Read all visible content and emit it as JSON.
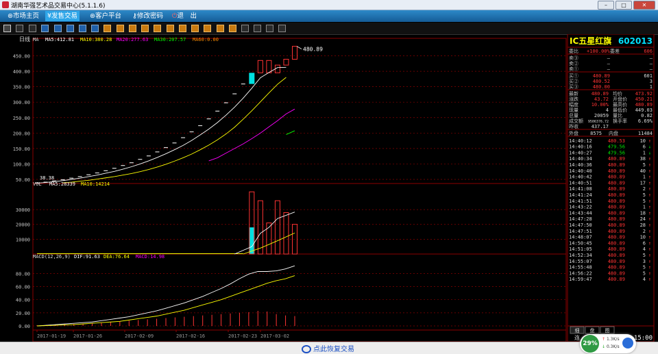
{
  "window": {
    "title": "湖南华强艺术品交易中心(5.1.1.6)"
  },
  "menu": [
    {
      "label": "市场主页",
      "icon": "globe-icon"
    },
    {
      "label": "发售交易",
      "icon": "money-icon",
      "active": true
    },
    {
      "label": "客户平台",
      "icon": "globe-icon"
    },
    {
      "label": "修改密码",
      "icon": "key-icon"
    },
    {
      "label": "退　出",
      "icon": "exit-icon"
    }
  ],
  "status": {
    "resume": "点此恢复交易"
  },
  "netwidget": {
    "percent": "29%",
    "up": "1.3K/s",
    "down": "0.3K/s"
  },
  "chart_data": [
    {
      "type": "candlestick",
      "title": "日线",
      "indicators_label": "MA",
      "ma_labels": [
        {
          "text": "MA5:412.81",
          "color": "#ffffff"
        },
        {
          "text": "MA10:380.28",
          "color": "#ffff00"
        },
        {
          "text": "MA20:277.63",
          "color": "#ff00ff"
        },
        {
          "text": "MA30:207.57",
          "color": "#00ff00"
        },
        {
          "text": "MA60:0.00",
          "color": "#ff8c00"
        }
      ],
      "yticks": [
        "450.00",
        "400.00",
        "350.00",
        "300.00",
        "250.00",
        "200.00",
        "150.00",
        "100.00",
        "50.00"
      ],
      "ylim": [
        50,
        480
      ],
      "xticks": [
        "2017-01-19",
        "2017-01-26",
        "2017-02-09",
        "2017-02-16",
        "2017-02-23",
        "2017-03-02"
      ],
      "high_label": "480.89",
      "low_label": "38.38",
      "close": [
        38.38,
        41,
        45,
        49,
        54,
        59,
        65,
        71,
        78,
        86,
        95,
        104,
        115,
        126,
        139,
        153,
        168,
        185,
        204,
        224,
        246,
        271,
        298,
        327,
        359,
        395,
        435,
        395,
        420,
        439,
        480.89
      ],
      "ma5": [
        38,
        40,
        43,
        46,
        50,
        54,
        59,
        64,
        70,
        76,
        83,
        91,
        100,
        110,
        121,
        133,
        146,
        160,
        176,
        194,
        213,
        234,
        258,
        284,
        313,
        345,
        379,
        396,
        412,
        412.81
      ],
      "ma10": [
        39,
        41,
        44,
        47,
        51,
        55,
        59,
        64,
        69,
        75,
        82,
        90,
        99,
        109,
        120,
        132,
        146,
        161,
        178,
        197,
        219,
        245,
        272,
        301,
        330,
        358,
        380.28
      ],
      "ma20": [
        110,
        120,
        135,
        150,
        165,
        182,
        200,
        220,
        240,
        262,
        277.63
      ],
      "ma30": [
        195,
        207.57
      ]
    },
    {
      "type": "bar",
      "title": "VOL",
      "ma_labels": [
        {
          "text": "MA5:28339",
          "color": "#ffffff"
        },
        {
          "text": "MA10:14214",
          "color": "#ffff00"
        }
      ],
      "yticks": [
        "30000",
        "20000",
        "10000"
      ],
      "ylim": [
        0,
        43000
      ],
      "values": [
        18000,
        42000,
        36000,
        21000,
        36000,
        28000,
        20059
      ]
    },
    {
      "type": "line",
      "title": "MACD(12,26,9)",
      "ma_labels": [
        {
          "text": "DIF:91.63",
          "color": "#ffffff"
        },
        {
          "text": "DEA:76.64",
          "color": "#ffff00"
        },
        {
          "text": "MACD:14.98",
          "color": "#ff00ff"
        }
      ],
      "yticks": [
        "80.00",
        "60.00",
        "40.00",
        "20.00",
        "0.00"
      ],
      "ylim": [
        0,
        95
      ],
      "dif": [
        0,
        1,
        2,
        3,
        4,
        5,
        6,
        8,
        10,
        12,
        14,
        17,
        20,
        23,
        27,
        31,
        35,
        40,
        45,
        51,
        57,
        64,
        72,
        79,
        83,
        83,
        84,
        87,
        91.63
      ],
      "dea": [
        0,
        0.5,
        1,
        1.5,
        2,
        3,
        4,
        5,
        6,
        7,
        9,
        11,
        13,
        15,
        18,
        21,
        24,
        28,
        32,
        36,
        40,
        45,
        50,
        55,
        60,
        65,
        69,
        72,
        76.64
      ],
      "hist": [
        1,
        1.5,
        2,
        2.5,
        3,
        3.5,
        4,
        5,
        6,
        7,
        8,
        9,
        10,
        11,
        12,
        13,
        14,
        15,
        16,
        17,
        18,
        19,
        20,
        21,
        23,
        22,
        18,
        16,
        14.98
      ]
    }
  ],
  "quote": {
    "name": "IC五星红旗",
    "code": "602013",
    "weibi": {
      "label": "委比",
      "value": "+100.00%",
      "diff_label": "委差",
      "diff": "606"
    },
    "sells": [
      {
        "label": "卖③",
        "price": "—",
        "vol": "—"
      },
      {
        "label": "卖②",
        "price": "—",
        "vol": "—"
      },
      {
        "label": "卖①",
        "price": "—",
        "vol": "—"
      }
    ],
    "buys": [
      {
        "label": "买①",
        "price": "480.89",
        "vol": "601"
      },
      {
        "label": "买②",
        "price": "480.52",
        "vol": "3"
      },
      {
        "label": "买③",
        "price": "480.00",
        "vol": "1"
      }
    ],
    "stats": [
      {
        "l1": "最新",
        "v1": "480.89",
        "l2": "均价",
        "v2": "473.92"
      },
      {
        "l1": "涨跌",
        "v1": "43.72",
        "l2": "开盘价",
        "v2": "450.21"
      },
      {
        "l1": "幅度",
        "v1": "10.00%",
        "l2": "最高价",
        "v2": "480.89"
      },
      {
        "l1": "现量",
        "v1": "4",
        "l2": "最低价",
        "v2": "449.03"
      },
      {
        "l1": "总量",
        "v1": "20059",
        "l2": "量比",
        "v2": "0.82"
      },
      {
        "l1": "成交额",
        "v1": "9506376.72",
        "l2": "换手率",
        "v2": "6.69%"
      },
      {
        "l1": "昨收",
        "v1": "437.17",
        "l2": "",
        "v2": ""
      }
    ],
    "outer": {
      "label": "外盘",
      "value": "8575",
      "inner_label": "内盘",
      "inner": "11484"
    },
    "ticks": [
      {
        "t": "14:40:12",
        "p": "480.53",
        "v": "10",
        "d": "up"
      },
      {
        "t": "14:40:16",
        "p": "479.56",
        "v": "6",
        "d": "down"
      },
      {
        "t": "14:40:27",
        "p": "479.56",
        "v": "1",
        "d": "down"
      },
      {
        "t": "14:40:34",
        "p": "480.89",
        "v": "38",
        "d": "up"
      },
      {
        "t": "14:40:36",
        "p": "480.89",
        "v": "5",
        "d": "up"
      },
      {
        "t": "14:40:40",
        "p": "480.89",
        "v": "40",
        "d": "up"
      },
      {
        "t": "14:40:42",
        "p": "480.89",
        "v": "1",
        "d": "up"
      },
      {
        "t": "14:40:51",
        "p": "480.89",
        "v": "17",
        "d": "up"
      },
      {
        "t": "14:41:08",
        "p": "480.89",
        "v": "2",
        "d": "up"
      },
      {
        "t": "14:41:24",
        "p": "480.89",
        "v": "5",
        "d": "up"
      },
      {
        "t": "14:41:51",
        "p": "480.89",
        "v": "5",
        "d": "up"
      },
      {
        "t": "14:43:22",
        "p": "480.89",
        "v": "1",
        "d": "up"
      },
      {
        "t": "14:43:44",
        "p": "480.89",
        "v": "18",
        "d": "up"
      },
      {
        "t": "14:47:28",
        "p": "480.89",
        "v": "24",
        "d": "up"
      },
      {
        "t": "14:47:50",
        "p": "480.89",
        "v": "28",
        "d": "up"
      },
      {
        "t": "14:47:51",
        "p": "480.89",
        "v": "2",
        "d": "up"
      },
      {
        "t": "14:48:07",
        "p": "480.89",
        "v": "10",
        "d": "up"
      },
      {
        "t": "14:50:45",
        "p": "480.89",
        "v": "6",
        "d": "up"
      },
      {
        "t": "14:51:05",
        "p": "480.89",
        "v": "4",
        "d": "up"
      },
      {
        "t": "14:52:34",
        "p": "480.89",
        "v": "5",
        "d": "up"
      },
      {
        "t": "14:55:07",
        "p": "480.89",
        "v": "3",
        "d": "up"
      },
      {
        "t": "14:55:48",
        "p": "480.89",
        "v": "5",
        "d": "up"
      },
      {
        "t": "14:56:22",
        "p": "480.89",
        "v": "5",
        "d": "up"
      },
      {
        "t": "14:59:47",
        "p": "480.89",
        "v": "4",
        "d": "up"
      }
    ],
    "tabs": [
      "细",
      "盘",
      "图"
    ],
    "time_prefix": "连",
    "clock": "15:00"
  },
  "colors": {
    "up": "#ff3333",
    "down": "#00e0e0",
    "grid": "#8b0000",
    "text": "#c0c0c0"
  }
}
